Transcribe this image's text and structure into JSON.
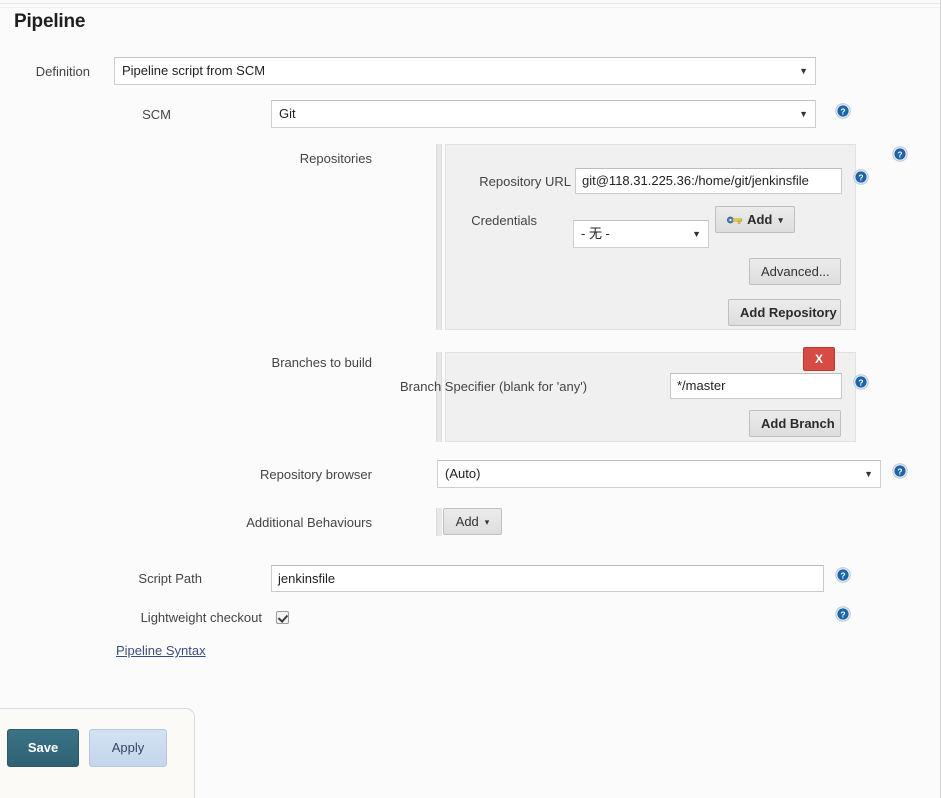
{
  "page": {
    "title": "Pipeline"
  },
  "definition": {
    "label": "Definition",
    "value": "Pipeline script from SCM",
    "caret": "▼"
  },
  "scm": {
    "label": "SCM",
    "value": "Git",
    "caret": "▼",
    "help_icon": "help-icon"
  },
  "repositories": {
    "label": "Repositories",
    "help_icon": "help-icon",
    "repository_url": {
      "label": "Repository URL",
      "value": "git@118.31.225.36:/home/git/jenkinsfile",
      "help_icon": "help-icon"
    },
    "credentials": {
      "label": "Credentials",
      "value": "- 无 -",
      "caret": "▼",
      "add_label": "Add",
      "add_caret": "▾",
      "add_icon": "key-icon"
    },
    "advanced_label": "Advanced...",
    "add_repository_label": "Add Repository"
  },
  "branches": {
    "label": "Branches to build",
    "delete_label": "X",
    "specifier": {
      "label": "Branch Specifier (blank for 'any')",
      "value": "*/master",
      "help_icon": "help-icon"
    },
    "add_branch_label": "Add Branch"
  },
  "repository_browser": {
    "label": "Repository browser",
    "value": "(Auto)",
    "caret": "▼",
    "help_icon": "help-icon"
  },
  "additional_behaviours": {
    "label": "Additional Behaviours",
    "add_label": "Add",
    "add_caret": "▾"
  },
  "script_path": {
    "label": "Script Path",
    "value": "jenkinsfile",
    "help_icon": "help-icon"
  },
  "lightweight_checkout": {
    "label": "Lightweight checkout",
    "checked": true,
    "help_icon": "help-icon"
  },
  "pipeline_syntax": {
    "label": "Pipeline Syntax"
  },
  "actions": {
    "save_label": "Save",
    "apply_label": "Apply"
  },
  "colors": {
    "save_button": "#346b7d",
    "apply_button": "#ccdcf0",
    "delete_button": "#d64b43",
    "help_icon": "#1d65a6",
    "link": "#3a4f7a",
    "panel_bg": "#f0f0f0",
    "page_bg": "#fbfbfb"
  }
}
